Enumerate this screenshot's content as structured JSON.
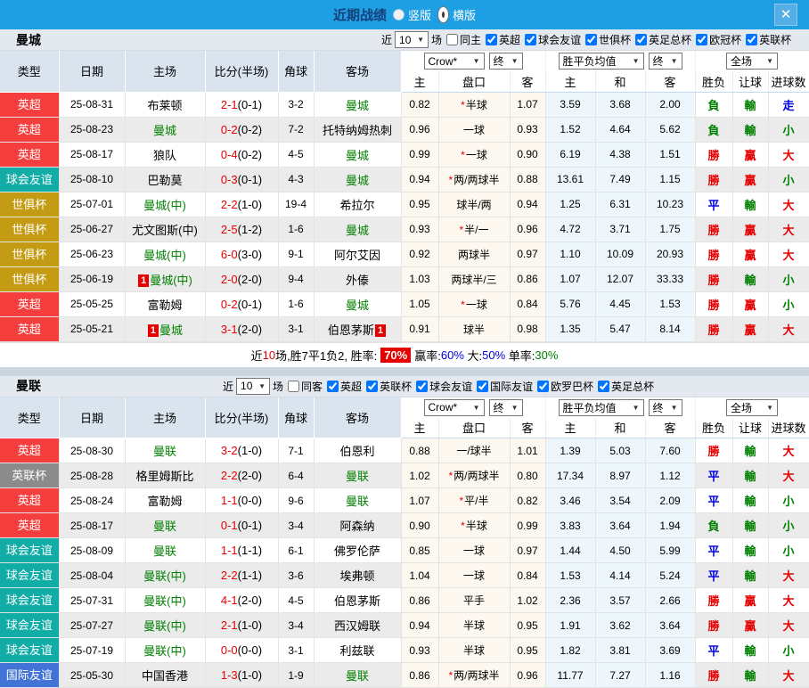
{
  "header": {
    "title": "近期战绩",
    "radio_vertical": "竖版",
    "radio_horizontal": "横版",
    "selected": "横版",
    "close": "✕"
  },
  "columns": {
    "type": "类型",
    "date": "日期",
    "home": "主场",
    "score": "比分(半场)",
    "corner": "角球",
    "away": "客场",
    "bookmaker": "Crow*",
    "final": "终",
    "avg": "胜平负均值",
    "scope": "全场",
    "sub": [
      "主",
      "盘口",
      "客",
      "主",
      "和",
      "客",
      "胜负",
      "让球",
      "进球数"
    ]
  },
  "filter_labels": {
    "near": "近",
    "games": "场"
  },
  "colors": {
    "red": "#e60000",
    "green": "#008000",
    "blue": "#0000dd",
    "black": "#000000",
    "white": "#ffffff"
  },
  "league_colors": {
    "英超": "#f53e3e",
    "球会友谊": "#12aca6",
    "世俱杯": "#c49c14",
    "英联杯": "#8b8b8b",
    "国际友谊": "#4274d8"
  },
  "sections": [
    {
      "team": "曼城",
      "filter": {
        "games": "10",
        "same_label": "同主",
        "same_checked": false,
        "leagues": [
          "英超",
          "球会友谊",
          "世俱杯",
          "英足总杯",
          "欧冠杯",
          "英联杯"
        ]
      },
      "rows": [
        {
          "league": "英超",
          "date": "25-08-31",
          "home": {
            "name": "布莱顿"
          },
          "score": "2-1",
          "half": "(0-1)",
          "corner": "3-2",
          "away": {
            "name": "曼城",
            "self": true
          },
          "h": "0.82",
          "star": true,
          "handicap": "半球",
          "a": "1.07",
          "avg": [
            "3.59",
            "3.68",
            "2.00"
          ],
          "res": [
            "負",
            "green"
          ],
          "let": [
            "輸",
            "green"
          ],
          "goal": [
            "走",
            "blue"
          ]
        },
        {
          "league": "英超",
          "date": "25-08-23",
          "home": {
            "name": "曼城",
            "self": true
          },
          "score": "0-2",
          "half": "(0-2)",
          "corner": "7-2",
          "away": {
            "name": "托特纳姆热刺"
          },
          "h": "0.96",
          "star": false,
          "handicap": "一球",
          "a": "0.93",
          "avg": [
            "1.52",
            "4.64",
            "5.62"
          ],
          "res": [
            "負",
            "green"
          ],
          "let": [
            "輸",
            "green"
          ],
          "goal": [
            "小",
            "green"
          ]
        },
        {
          "league": "英超",
          "date": "25-08-17",
          "home": {
            "name": "狼队"
          },
          "score": "0-4",
          "half": "(0-2)",
          "corner": "4-5",
          "away": {
            "name": "曼城",
            "self": true
          },
          "h": "0.99",
          "star": true,
          "handicap": "一球",
          "a": "0.90",
          "avg": [
            "6.19",
            "4.38",
            "1.51"
          ],
          "res": [
            "勝",
            "red"
          ],
          "let": [
            "贏",
            "red"
          ],
          "goal": [
            "大",
            "red"
          ]
        },
        {
          "league": "球会友谊",
          "date": "25-08-10",
          "home": {
            "name": "巴勒莫"
          },
          "score": "0-3",
          "half": "(0-1)",
          "corner": "4-3",
          "away": {
            "name": "曼城",
            "self": true
          },
          "h": "0.94",
          "star": true,
          "handicap": "两/两球半",
          "a": "0.88",
          "avg": [
            "13.61",
            "7.49",
            "1.15"
          ],
          "res": [
            "勝",
            "red"
          ],
          "let": [
            "贏",
            "red"
          ],
          "goal": [
            "小",
            "green"
          ]
        },
        {
          "league": "世俱杯",
          "date": "25-07-01",
          "home": {
            "name": "曼城(中)",
            "self": true
          },
          "score": "2-2",
          "half": "(1-0)",
          "corner": "19-4",
          "away": {
            "name": "希拉尔"
          },
          "h": "0.95",
          "star": false,
          "handicap": "球半/两",
          "a": "0.94",
          "avg": [
            "1.25",
            "6.31",
            "10.23"
          ],
          "res": [
            "平",
            "blue"
          ],
          "let": [
            "輸",
            "green"
          ],
          "goal": [
            "大",
            "red"
          ]
        },
        {
          "league": "世俱杯",
          "date": "25-06-27",
          "home": {
            "name": "尤文图斯(中)"
          },
          "score": "2-5",
          "half": "(1-2)",
          "corner": "1-6",
          "away": {
            "name": "曼城",
            "self": true
          },
          "h": "0.93",
          "star": true,
          "handicap": "半/一",
          "a": "0.96",
          "avg": [
            "4.72",
            "3.71",
            "1.75"
          ],
          "res": [
            "勝",
            "red"
          ],
          "let": [
            "贏",
            "red"
          ],
          "goal": [
            "大",
            "red"
          ]
        },
        {
          "league": "世俱杯",
          "date": "25-06-23",
          "home": {
            "name": "曼城(中)",
            "self": true
          },
          "score": "6-0",
          "half": "(3-0)",
          "corner": "9-1",
          "away": {
            "name": "阿尔艾因"
          },
          "h": "0.92",
          "star": false,
          "handicap": "两球半",
          "a": "0.97",
          "avg": [
            "1.10",
            "10.09",
            "20.93"
          ],
          "res": [
            "勝",
            "red"
          ],
          "let": [
            "贏",
            "red"
          ],
          "goal": [
            "大",
            "red"
          ]
        },
        {
          "league": "世俱杯",
          "date": "25-06-19",
          "home": {
            "name": "曼城(中)",
            "self": true,
            "badge": "1",
            "badge_pos": "before"
          },
          "score": "2-0",
          "half": "(2-0)",
          "corner": "9-4",
          "away": {
            "name": "外傣"
          },
          "h": "1.03",
          "star": false,
          "handicap": "两球半/三",
          "a": "0.86",
          "avg": [
            "1.07",
            "12.07",
            "33.33"
          ],
          "res": [
            "勝",
            "red"
          ],
          "let": [
            "輸",
            "green"
          ],
          "goal": [
            "小",
            "green"
          ]
        },
        {
          "league": "英超",
          "date": "25-05-25",
          "home": {
            "name": "富勒姆"
          },
          "score": "0-2",
          "half": "(0-1)",
          "corner": "1-6",
          "away": {
            "name": "曼城",
            "self": true
          },
          "h": "1.05",
          "star": true,
          "handicap": "一球",
          "a": "0.84",
          "avg": [
            "5.76",
            "4.45",
            "1.53"
          ],
          "res": [
            "勝",
            "red"
          ],
          "let": [
            "贏",
            "red"
          ],
          "goal": [
            "小",
            "green"
          ]
        },
        {
          "league": "英超",
          "date": "25-05-21",
          "home": {
            "name": "曼城",
            "self": true,
            "badge": "1",
            "badge_pos": "before"
          },
          "score": "3-1",
          "half": "(2-0)",
          "corner": "3-1",
          "away": {
            "name": "伯恩茅斯",
            "badge": "1",
            "badge_pos": "after"
          },
          "h": "0.91",
          "star": false,
          "handicap": "球半",
          "a": "0.98",
          "avg": [
            "1.35",
            "5.47",
            "8.14"
          ],
          "res": [
            "勝",
            "red"
          ],
          "let": [
            "贏",
            "red"
          ],
          "goal": [
            "大",
            "red"
          ]
        }
      ],
      "summary": {
        "parts": [
          {
            "t": "近"
          },
          {
            "t": "10",
            "c": "red"
          },
          {
            "t": "场,胜7平1负2, 胜率:"
          },
          {
            "t": "70%",
            "c": "white",
            "bg": "red"
          },
          {
            "t": "赢率:"
          },
          {
            "t": "60%",
            "c": "blue"
          },
          {
            "t": " 大:"
          },
          {
            "t": "50%",
            "c": "blue"
          },
          {
            "t": " 单率:"
          },
          {
            "t": "30%",
            "c": "green"
          }
        ]
      }
    },
    {
      "team": "曼联",
      "filter": {
        "games": "10",
        "same_label": "同客",
        "same_checked": false,
        "leagues": [
          "英超",
          "英联杯",
          "球会友谊",
          "国际友谊",
          "欧罗巴杯",
          "英足总杯"
        ]
      },
      "rows": [
        {
          "league": "英超",
          "date": "25-08-30",
          "home": {
            "name": "曼联",
            "self": true
          },
          "score": "3-2",
          "half": "(1-0)",
          "corner": "7-1",
          "away": {
            "name": "伯恩利"
          },
          "h": "0.88",
          "star": false,
          "handicap": "一/球半",
          "a": "1.01",
          "avg": [
            "1.39",
            "5.03",
            "7.60"
          ],
          "res": [
            "勝",
            "red"
          ],
          "let": [
            "輸",
            "green"
          ],
          "goal": [
            "大",
            "red"
          ]
        },
        {
          "league": "英联杯",
          "date": "25-08-28",
          "home": {
            "name": "格里姆斯比"
          },
          "score": "2-2",
          "half": "(2-0)",
          "corner": "6-4",
          "away": {
            "name": "曼联",
            "self": true
          },
          "h": "1.02",
          "star": true,
          "handicap": "两/两球半",
          "a": "0.80",
          "avg": [
            "17.34",
            "8.97",
            "1.12"
          ],
          "res": [
            "平",
            "blue"
          ],
          "let": [
            "輸",
            "green"
          ],
          "goal": [
            "大",
            "red"
          ]
        },
        {
          "league": "英超",
          "date": "25-08-24",
          "home": {
            "name": "富勒姆"
          },
          "score": "1-1",
          "half": "(0-0)",
          "corner": "9-6",
          "away": {
            "name": "曼联",
            "self": true
          },
          "h": "1.07",
          "star": true,
          "handicap": "平/半",
          "a": "0.82",
          "avg": [
            "3.46",
            "3.54",
            "2.09"
          ],
          "res": [
            "平",
            "blue"
          ],
          "let": [
            "輸",
            "green"
          ],
          "goal": [
            "小",
            "green"
          ]
        },
        {
          "league": "英超",
          "date": "25-08-17",
          "home": {
            "name": "曼联",
            "self": true
          },
          "score": "0-1",
          "half": "(0-1)",
          "corner": "3-4",
          "away": {
            "name": "阿森纳"
          },
          "h": "0.90",
          "star": true,
          "handicap": "半球",
          "a": "0.99",
          "avg": [
            "3.83",
            "3.64",
            "1.94"
          ],
          "res": [
            "負",
            "green"
          ],
          "let": [
            "輸",
            "green"
          ],
          "goal": [
            "小",
            "green"
          ]
        },
        {
          "league": "球会友谊",
          "date": "25-08-09",
          "home": {
            "name": "曼联",
            "self": true
          },
          "score": "1-1",
          "half": "(1-1)",
          "corner": "6-1",
          "away": {
            "name": "佛罗伦萨"
          },
          "h": "0.85",
          "star": false,
          "handicap": "一球",
          "a": "0.97",
          "avg": [
            "1.44",
            "4.50",
            "5.99"
          ],
          "res": [
            "平",
            "blue"
          ],
          "let": [
            "輸",
            "green"
          ],
          "goal": [
            "小",
            "green"
          ]
        },
        {
          "league": "球会友谊",
          "date": "25-08-04",
          "home": {
            "name": "曼联(中)",
            "self": true
          },
          "score": "2-2",
          "half": "(1-1)",
          "corner": "3-6",
          "away": {
            "name": "埃弗顿"
          },
          "h": "1.04",
          "star": false,
          "handicap": "一球",
          "a": "0.84",
          "avg": [
            "1.53",
            "4.14",
            "5.24"
          ],
          "res": [
            "平",
            "blue"
          ],
          "let": [
            "輸",
            "green"
          ],
          "goal": [
            "大",
            "red"
          ]
        },
        {
          "league": "球会友谊",
          "date": "25-07-31",
          "home": {
            "name": "曼联(中)",
            "self": true
          },
          "score": "4-1",
          "half": "(2-0)",
          "corner": "4-5",
          "away": {
            "name": "伯恩茅斯"
          },
          "h": "0.86",
          "star": false,
          "handicap": "平手",
          "a": "1.02",
          "avg": [
            "2.36",
            "3.57",
            "2.66"
          ],
          "res": [
            "勝",
            "red"
          ],
          "let": [
            "贏",
            "red"
          ],
          "goal": [
            "大",
            "red"
          ]
        },
        {
          "league": "球会友谊",
          "date": "25-07-27",
          "home": {
            "name": "曼联(中)",
            "self": true
          },
          "score": "2-1",
          "half": "(1-0)",
          "corner": "3-4",
          "away": {
            "name": "西汉姆联"
          },
          "h": "0.94",
          "star": false,
          "handicap": "半球",
          "a": "0.95",
          "avg": [
            "1.91",
            "3.62",
            "3.64"
          ],
          "res": [
            "勝",
            "red"
          ],
          "let": [
            "贏",
            "red"
          ],
          "goal": [
            "大",
            "red"
          ]
        },
        {
          "league": "球会友谊",
          "date": "25-07-19",
          "home": {
            "name": "曼联(中)",
            "self": true
          },
          "score": "0-0",
          "half": "(0-0)",
          "corner": "3-1",
          "away": {
            "name": "利兹联"
          },
          "h": "0.93",
          "star": false,
          "handicap": "半球",
          "a": "0.95",
          "avg": [
            "1.82",
            "3.81",
            "3.69"
          ],
          "res": [
            "平",
            "blue"
          ],
          "let": [
            "輸",
            "green"
          ],
          "goal": [
            "小",
            "green"
          ]
        },
        {
          "league": "国际友谊",
          "date": "25-05-30",
          "home": {
            "name": "中国香港"
          },
          "score": "1-3",
          "half": "(1-0)",
          "corner": "1-9",
          "away": {
            "name": "曼联",
            "self": true
          },
          "h": "0.86",
          "star": true,
          "handicap": "两/两球半",
          "a": "0.96",
          "avg": [
            "11.77",
            "7.27",
            "1.16"
          ],
          "res": [
            "勝",
            "red"
          ],
          "let": [
            "輸",
            "green"
          ],
          "goal": [
            "大",
            "red"
          ]
        }
      ]
    }
  ]
}
